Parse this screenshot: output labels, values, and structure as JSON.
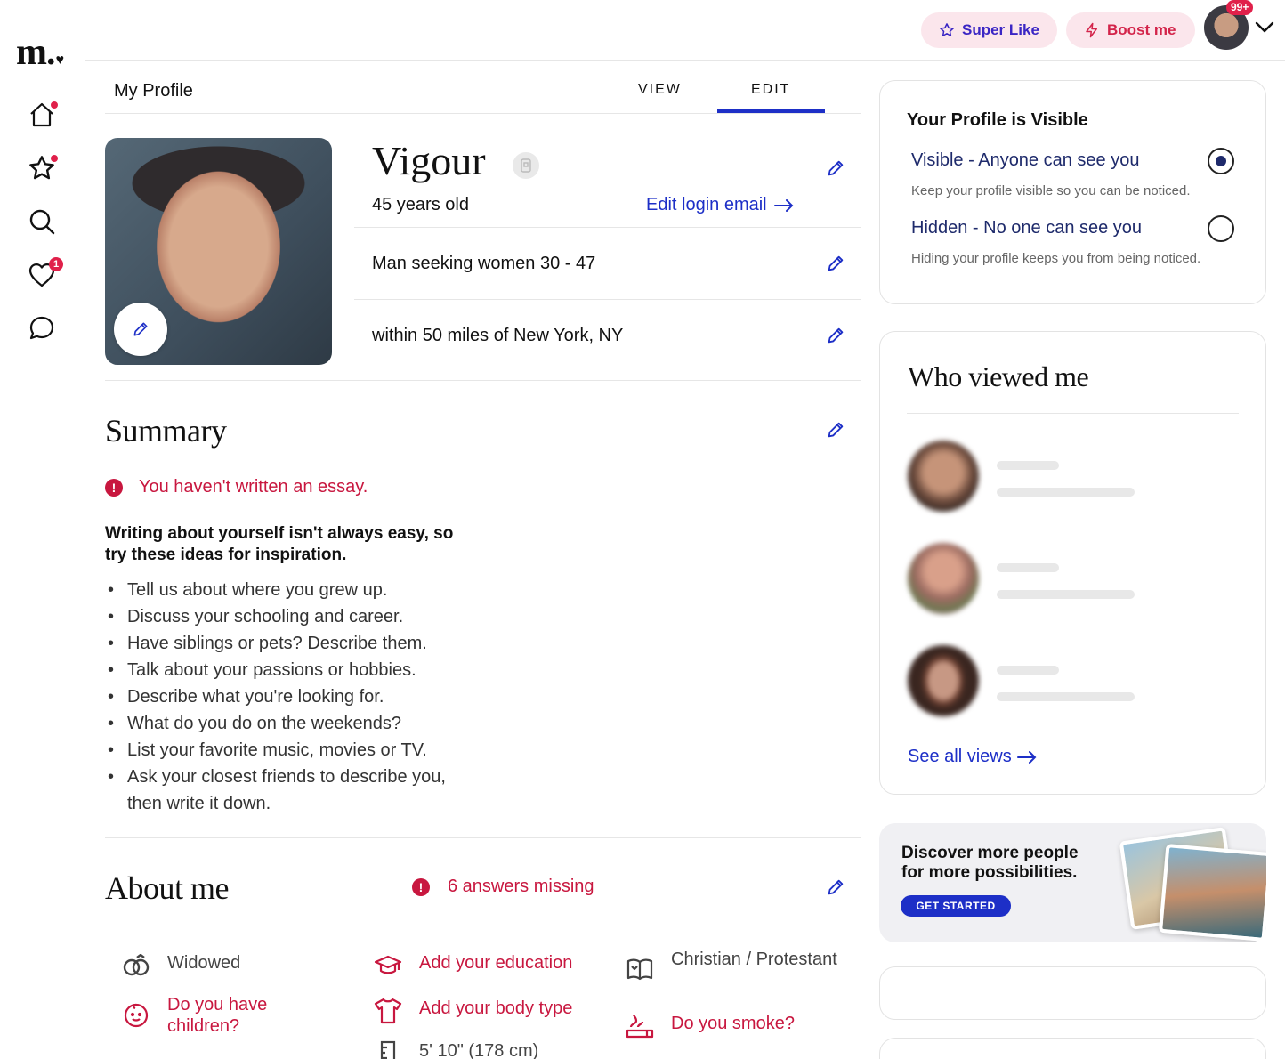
{
  "brand": {
    "logo_text": "m.",
    "logo_heart": "♥"
  },
  "header": {
    "super_like_label": "Super Like",
    "boost_label": "Boost me",
    "notification_badge": "99+",
    "accent_color": "#1d2fc7",
    "alert_color": "#c8173f"
  },
  "nav": {
    "items": [
      {
        "icon": "home-icon",
        "indicator": "dot"
      },
      {
        "icon": "star-icon",
        "indicator": "dot"
      },
      {
        "icon": "search-icon",
        "indicator": ""
      },
      {
        "icon": "heart-icon",
        "indicator": "1"
      },
      {
        "icon": "chat-icon",
        "indicator": ""
      }
    ]
  },
  "profile": {
    "page_title": "My Profile",
    "tabs": [
      "VIEW",
      "EDIT"
    ],
    "active_tab": "EDIT",
    "name": "Vigour",
    "age": "45 years old",
    "edit_login_email": "Edit login email",
    "seeking": "Man seeking women 30 - 47",
    "location": "within 50 miles of New York, NY"
  },
  "summary": {
    "heading": "Summary",
    "alert": "You haven't written an essay.",
    "alert_glyph": "!",
    "tips_title": "Writing about yourself isn't always easy, so try these ideas for inspiration.",
    "tips": [
      "Tell us about where you grew up.",
      "Discuss your schooling and career.",
      "Have siblings or pets? Describe them.",
      "Talk about your passions or hobbies.",
      "Describe what you're looking for.",
      "What do you do on the weekends?",
      "List your favorite music, movies or TV.",
      "Ask your closest friends to describe you, then write it down."
    ]
  },
  "about": {
    "heading": "About me",
    "missing": "6 answers missing",
    "items": [
      {
        "icon": "rings-icon",
        "text": "Widowed",
        "missing": false
      },
      {
        "icon": "graduation-cap-icon",
        "text": "Add your education",
        "missing": true
      },
      {
        "icon": "book-icon",
        "text": "Christian / Protestant",
        "missing": false
      },
      {
        "icon": "child-face-icon",
        "text": "Do you have children?",
        "missing": true
      },
      {
        "icon": "shirt-icon",
        "text": "Add your body type",
        "missing": true
      },
      {
        "icon": "smoking-icon",
        "text": "Do you smoke?",
        "missing": true
      },
      {
        "icon": "ruler-icon",
        "text": "5' 10\" (178 cm)",
        "missing": false
      }
    ]
  },
  "visibility": {
    "title": "Your Profile is Visible",
    "options": [
      {
        "label": "Visible - Anyone can see you",
        "description": "Keep your profile visible so you can be noticed.",
        "selected": true
      },
      {
        "label": "Hidden - No one can see you",
        "description": "Hiding your profile keeps you from being noticed.",
        "selected": false
      }
    ]
  },
  "who_viewed": {
    "title": "Who viewed me",
    "see_all": "See all views"
  },
  "promo": {
    "text": "Discover more people for more possibilities.",
    "button": "GET STARTED"
  }
}
